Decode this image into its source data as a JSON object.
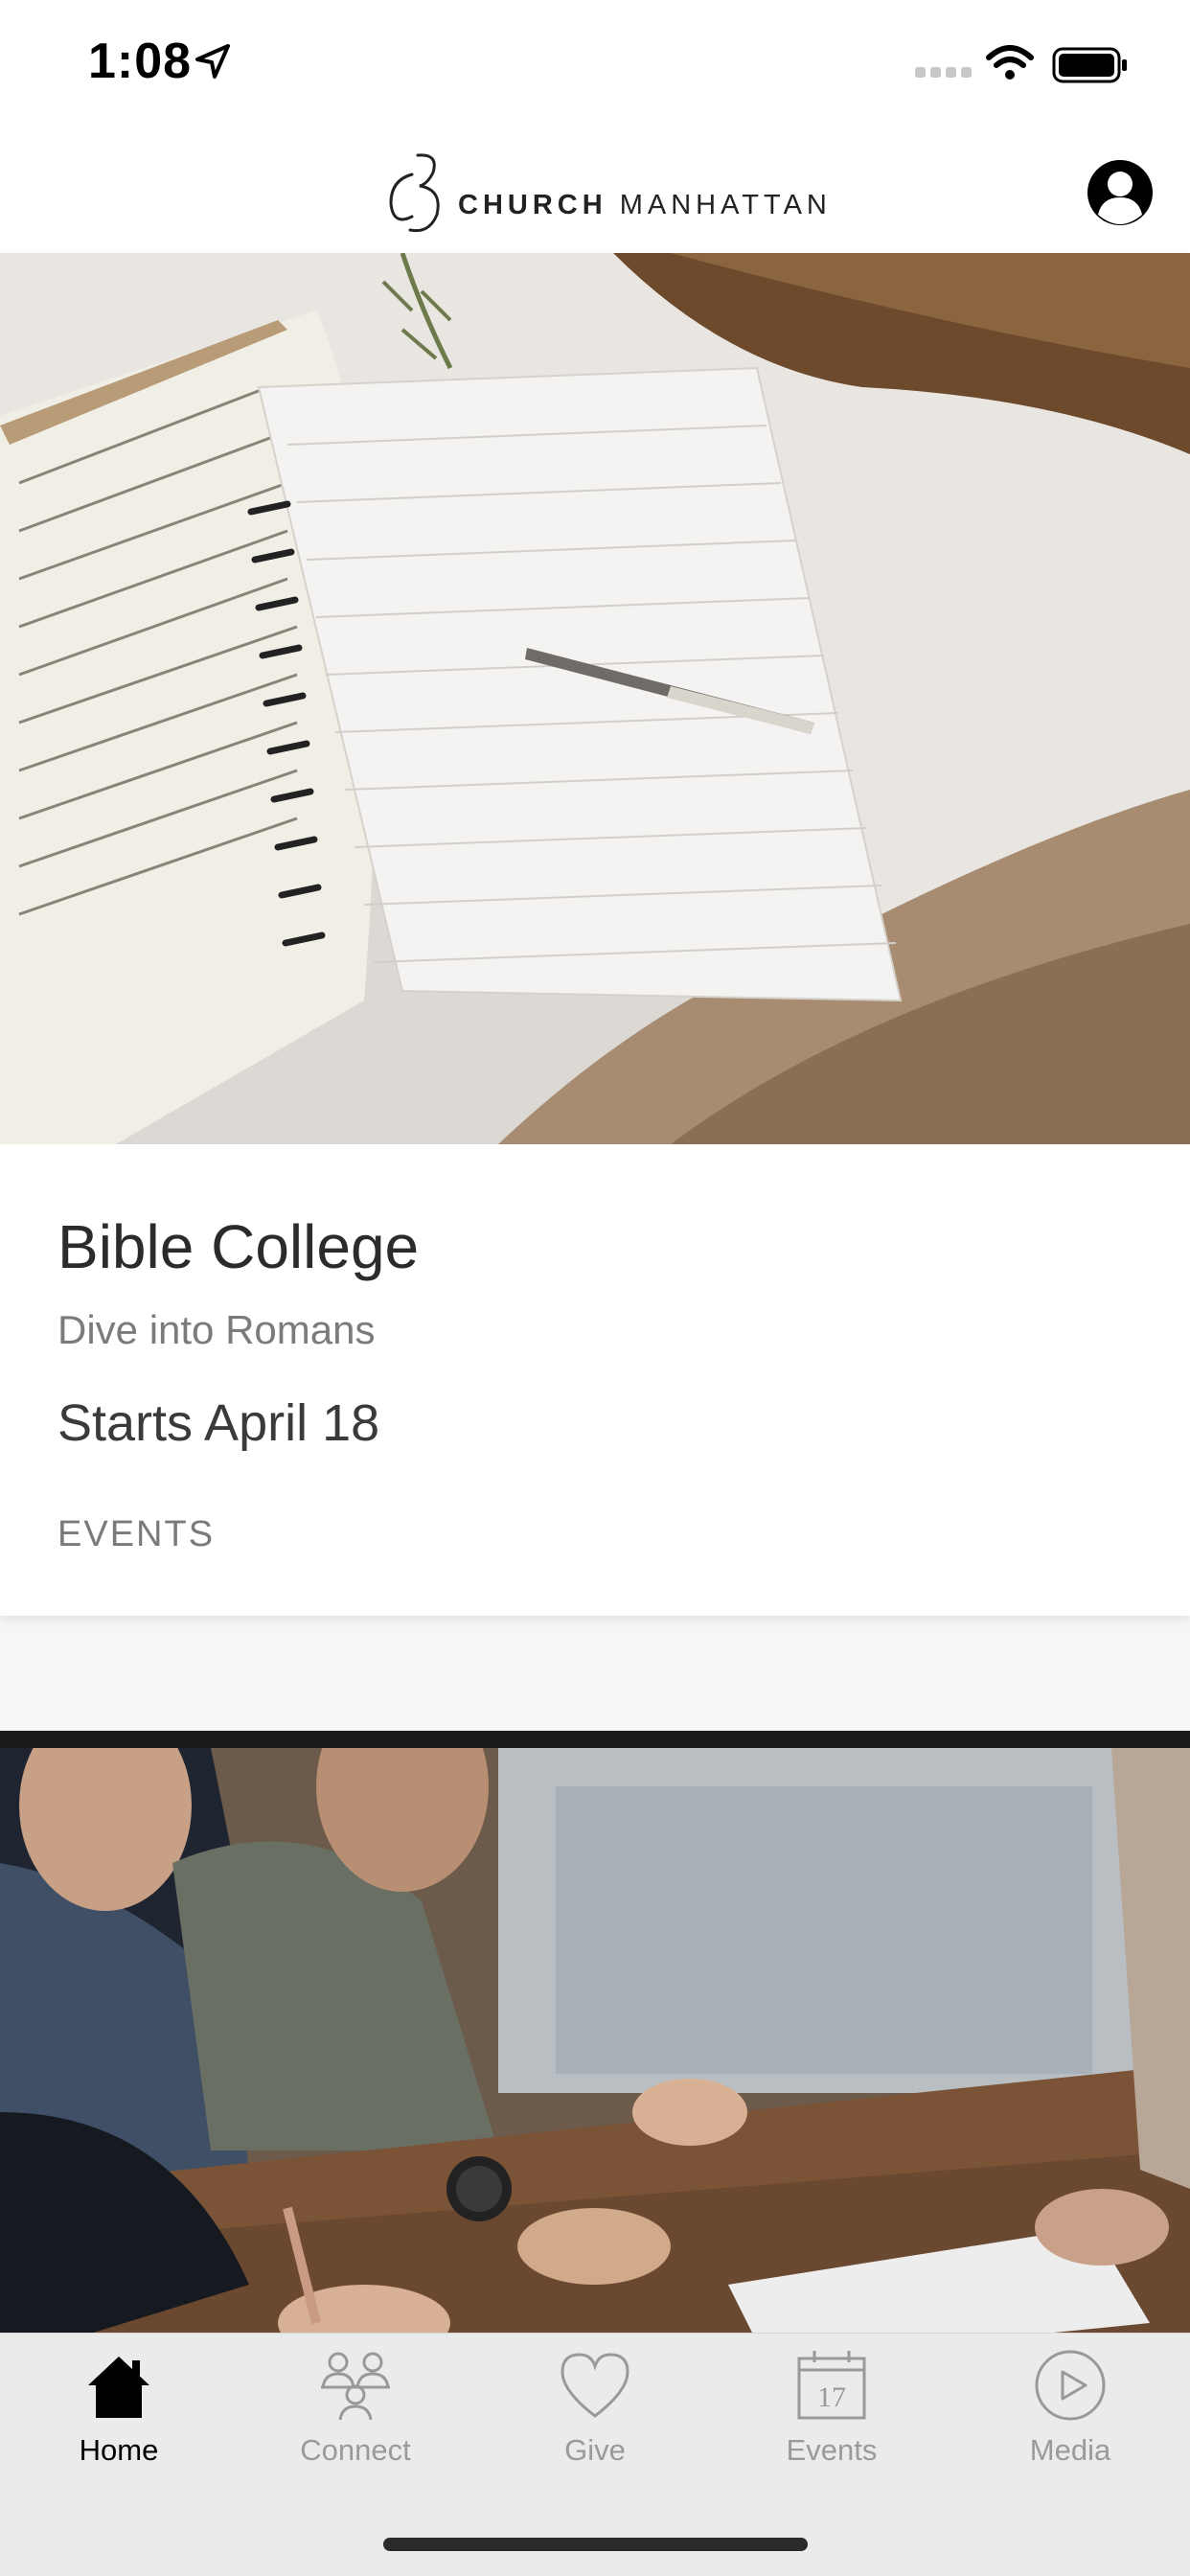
{
  "status_bar": {
    "time": "1:08"
  },
  "header": {
    "logo_mark": "C3",
    "logo_word_bold": "CHURCH",
    "logo_word_light": "MANHATTAN"
  },
  "cards": [
    {
      "title": "Bible College",
      "subtitle": "Dive into Romans",
      "date": "Starts April 18",
      "category": "EVENTS"
    }
  ],
  "tabs": [
    {
      "label": "Home",
      "icon": "home-icon",
      "active": true
    },
    {
      "label": "Connect",
      "icon": "people-icon",
      "active": false
    },
    {
      "label": "Give",
      "icon": "heart-icon",
      "active": false
    },
    {
      "label": "Events",
      "icon": "calendar-icon",
      "active": false,
      "calendar_day": "17"
    },
    {
      "label": "Media",
      "icon": "play-icon",
      "active": false
    }
  ],
  "colors": {
    "header_bg": "#ffffff",
    "tab_bar_bg": "#ebebeb",
    "active_tab": "#000000",
    "inactive_tab": "#9a9a9a"
  }
}
